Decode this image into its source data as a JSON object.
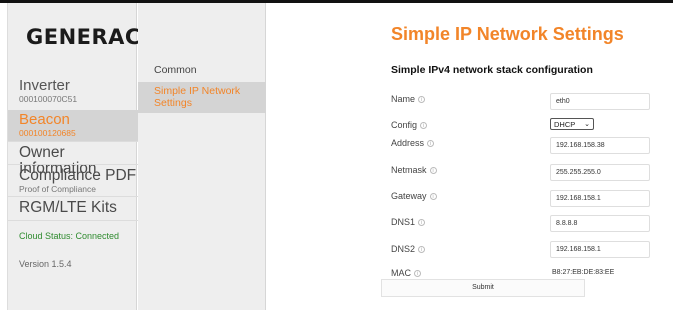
{
  "brand": {
    "logo_text": "GENERAC",
    "logo_mark": "®"
  },
  "sidebar": {
    "items": [
      {
        "label": "Inverter",
        "sub": "000100070C51"
      },
      {
        "label": "Beacon",
        "sub": "000100120685"
      },
      {
        "label": "Owner Information"
      },
      {
        "label": "Compliance PDF",
        "sub": "Proof of Compliance"
      },
      {
        "label": "RGM/LTE Kits"
      }
    ],
    "active_index": 1,
    "cloud_status": "Cloud Status: Connected",
    "version": "Version 1.5.4"
  },
  "subnav": {
    "items": [
      {
        "label": "Common"
      },
      {
        "label": "Simple IP Network Settings"
      }
    ],
    "active_index": 1
  },
  "main": {
    "title": "Simple IP Network Settings",
    "subtitle": "Simple IPv4 network stack configuration",
    "fields": {
      "name": {
        "label": "Name",
        "value": "eth0"
      },
      "config": {
        "label": "Config",
        "value": "DHCP"
      },
      "address": {
        "label": "Address",
        "value": "192.168.158.38"
      },
      "netmask": {
        "label": "Netmask",
        "value": "255.255.255.0"
      },
      "gateway": {
        "label": "Gateway",
        "value": "192.168.158.1"
      },
      "dns1": {
        "label": "DNS1",
        "value": "8.8.8.8"
      },
      "dns2": {
        "label": "DNS2",
        "value": "192.168.158.1"
      },
      "mac": {
        "label": "MAC",
        "value": "B8:27:EB:DE:83:EE"
      }
    },
    "submit_label": "Submit"
  },
  "icons": {
    "info": "info-icon",
    "dropdown": "chevron-down-icon"
  },
  "colors": {
    "accent": "#f28529",
    "cloud_status": "#2f8b2f"
  }
}
